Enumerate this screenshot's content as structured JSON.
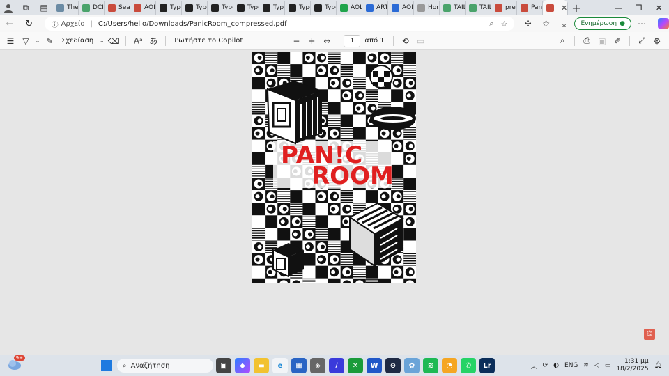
{
  "tabs": [
    {
      "label": "The",
      "fav_color": "#6b8ba4"
    },
    {
      "label": "DCIM",
      "fav_color": "#4aa36b"
    },
    {
      "label": "Searc",
      "fav_color": "#c94b3c"
    },
    {
      "label": "AOL",
      "fav_color": "#c94b3c"
    },
    {
      "label": "Type",
      "fav_color": "#222222"
    },
    {
      "label": "Type",
      "fav_color": "#222222"
    },
    {
      "label": "Type",
      "fav_color": "#222222"
    },
    {
      "label": "Type",
      "fav_color": "#222222"
    },
    {
      "label": "Type",
      "fav_color": "#222222"
    },
    {
      "label": "Type",
      "fav_color": "#222222"
    },
    {
      "label": "Type",
      "fav_color": "#222222"
    },
    {
      "label": "AOL",
      "fav_color": "#20a44c"
    },
    {
      "label": "ART",
      "fav_color": "#2b6bd6"
    },
    {
      "label": "AOL",
      "fav_color": "#2b6bd6"
    },
    {
      "label": "Hom",
      "fav_color": "#999999"
    },
    {
      "label": "TAIL",
      "fav_color": "#4aa36b"
    },
    {
      "label": "TAIL",
      "fav_color": "#4aa36b"
    },
    {
      "label": "pres",
      "fav_color": "#c94b3c"
    },
    {
      "label": "Pani",
      "fav_color": "#c94b3c"
    }
  ],
  "active_tab_label": "",
  "address": {
    "label": "Αρχείο",
    "path": "C:/Users/hello/Downloads/PanicRoom_compressed.pdf"
  },
  "update_button": "Ενημέρωση",
  "pdf_toolbar": {
    "draw_label": "Σχεδίαση",
    "copilot_label": "Ρωτήστε το Copilot",
    "page_number": "1",
    "page_of": "από 1"
  },
  "poster": {
    "title_line1": "PAN!C",
    "title_line2": "ROOM",
    "title_color": "#e02020"
  },
  "taskbar": {
    "weather_badge": "9+",
    "search_placeholder": "Αναζήτηση",
    "language": "ENG",
    "time": "1:31 μμ",
    "date": "18/2/2025"
  },
  "colors": {
    "accent": "#1e7ae0",
    "update_green": "#1a8a3a"
  }
}
